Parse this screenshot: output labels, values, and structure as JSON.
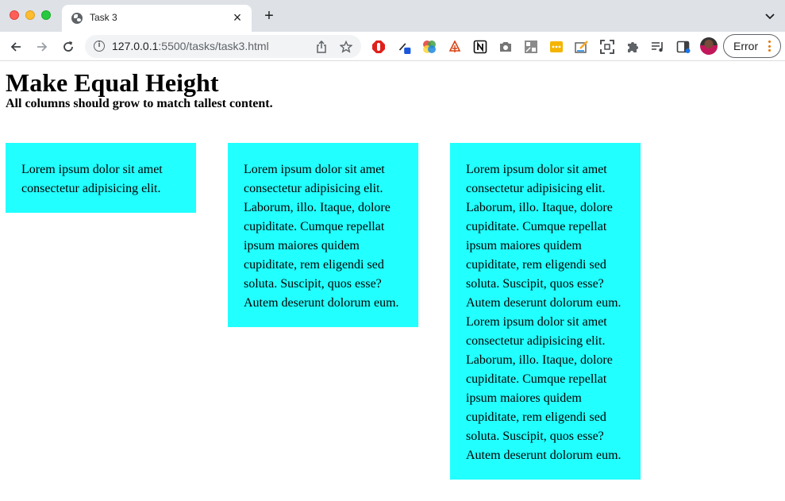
{
  "browser": {
    "tab": {
      "title": "Task 3"
    },
    "address": {
      "host": "127.0.0.1",
      "rest": ":5500/tasks/task3.html"
    },
    "profile_status": "Error",
    "colors": {
      "tabbar_bg": "#dee1e6",
      "omnibox_bg": "#f1f3f4",
      "error_accent": "#e37400"
    }
  },
  "page": {
    "title": "Make Equal Height",
    "subtitle": "All columns should grow to match tallest content.",
    "column_color": "#22ffff",
    "columns": [
      {
        "text": "Lorem ipsum dolor sit amet consectetur adipisicing elit."
      },
      {
        "text": "Lorem ipsum dolor sit amet consectetur adipisicing elit. Laborum, illo. Itaque, dolore cupiditate. Cumque repellat ipsum maiores quidem cupiditate, rem eligendi sed soluta. Suscipit, quos esse? Autem deserunt dolorum eum."
      },
      {
        "text": "Lorem ipsum dolor sit amet consectetur adipisicing elit. Laborum, illo. Itaque, dolore cupiditate. Cumque repellat ipsum maiores quidem cupiditate, rem eligendi sed soluta. Suscipit, quos esse? Autem deserunt dolorum eum. Lorem ipsum dolor sit amet consectetur adipisicing elit. Laborum, illo. Itaque, dolore cupiditate. Cumque repellat ipsum maiores quidem cupiditate, rem eligendi sed soluta. Suscipit, quos esse? Autem deserunt dolorum eum."
      }
    ]
  }
}
